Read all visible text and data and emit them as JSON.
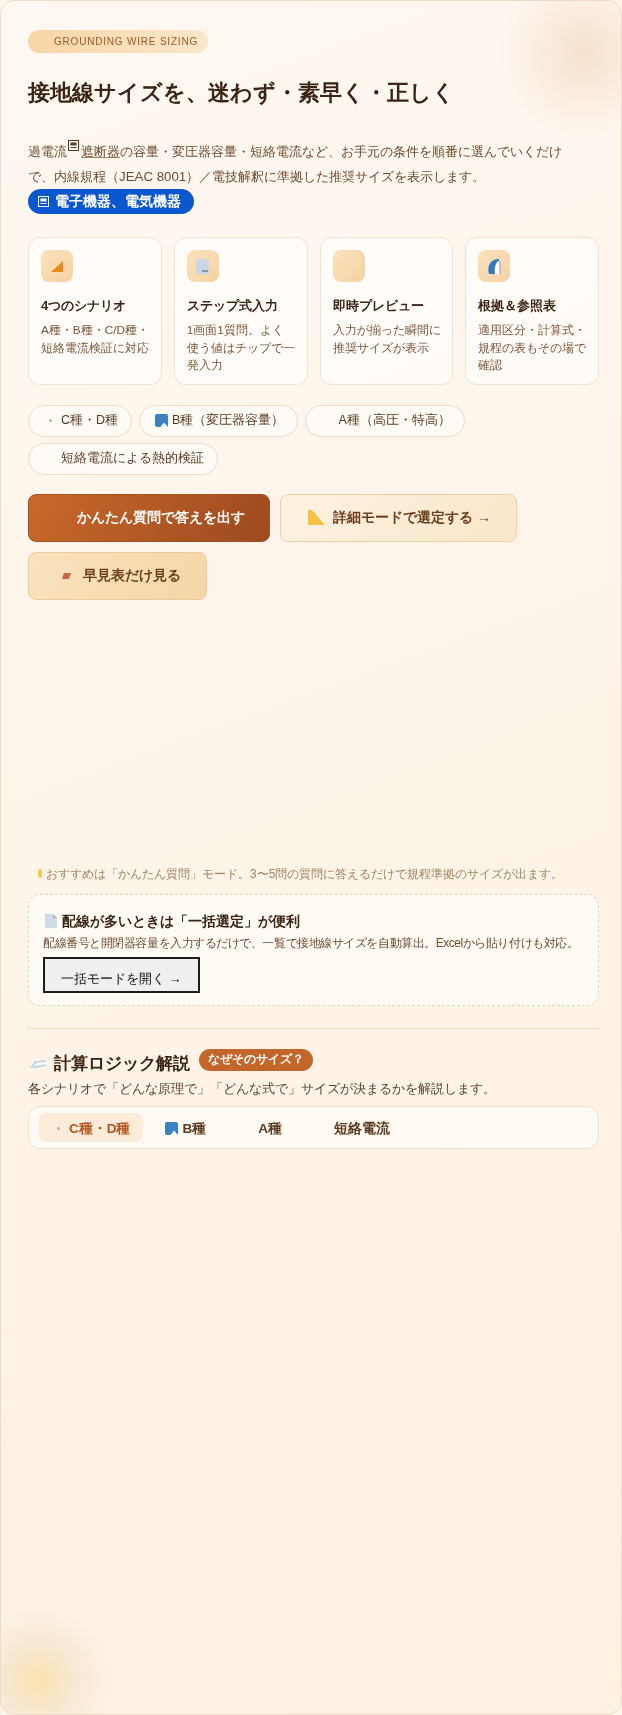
{
  "hero": {
    "eyebrow": "GROUNDING WIRE SIZING",
    "title": "接地線サイズを、迷わず・素早く・正しく",
    "description": {
      "before": "過電流",
      "link": "遮断器",
      "after": "の容量・変圧器容量・短絡電流など、お手元の条件を順番に選んでいくだけで、内線規程（JEAC 8001）／電技解釈に準拠した推奨サイズを表示します。"
    },
    "tooltip": "電子機器、電気機器"
  },
  "features": [
    {
      "title": "4つのシナリオ",
      "description": "A種・B種・C/D種・短絡電流検証に対応"
    },
    {
      "title": "ステップ式入力",
      "description": "1画面1質問。よく使う値はチップで一発入力"
    },
    {
      "title": "即時プレビュー",
      "description": "入力が揃った瞬間に推奨サイズが表示"
    },
    {
      "title": "根拠＆参照表",
      "description": "適用区分・計算式・規程の表もその場で確認"
    }
  ],
  "scenario_chips": [
    "C種・D種",
    "B種（変圧器容量）",
    "A種（高圧・特高）",
    "短絡電流による熱的検証"
  ],
  "actions": [
    {
      "label": "かんたん質問で答えを出す",
      "kind": "primary"
    },
    {
      "label": "詳細モードで選定する →",
      "kind": "secondary"
    },
    {
      "label": "早見表だけ見る",
      "kind": "tertiary"
    }
  ],
  "hint": "おすすめは「かんたん質問」モード。3〜5問の質問に答えるだけで規程準拠のサイズが出ます。",
  "bulk": {
    "title": "配線が多いときは「一括選定」が便利",
    "description": "配線番号と開閉器容量を入力するだけで、一覧で接地線サイズを自動算出。Excelから貼り付けも対応。",
    "button": "一括モードを開く →"
  },
  "logic": {
    "title": "計算ロジック解説",
    "badge": "なぜそのサイズ？",
    "subtitle": "各シナリオで「どんな原理で」「どんな式で」サイズが決まるかを解説します。",
    "tabs": [
      {
        "label": "C種・D種",
        "selected": true
      },
      {
        "label": "B種",
        "selected": false
      },
      {
        "label": "A種",
        "selected": false
      },
      {
        "label": "短絡電流",
        "selected": false
      }
    ]
  }
}
